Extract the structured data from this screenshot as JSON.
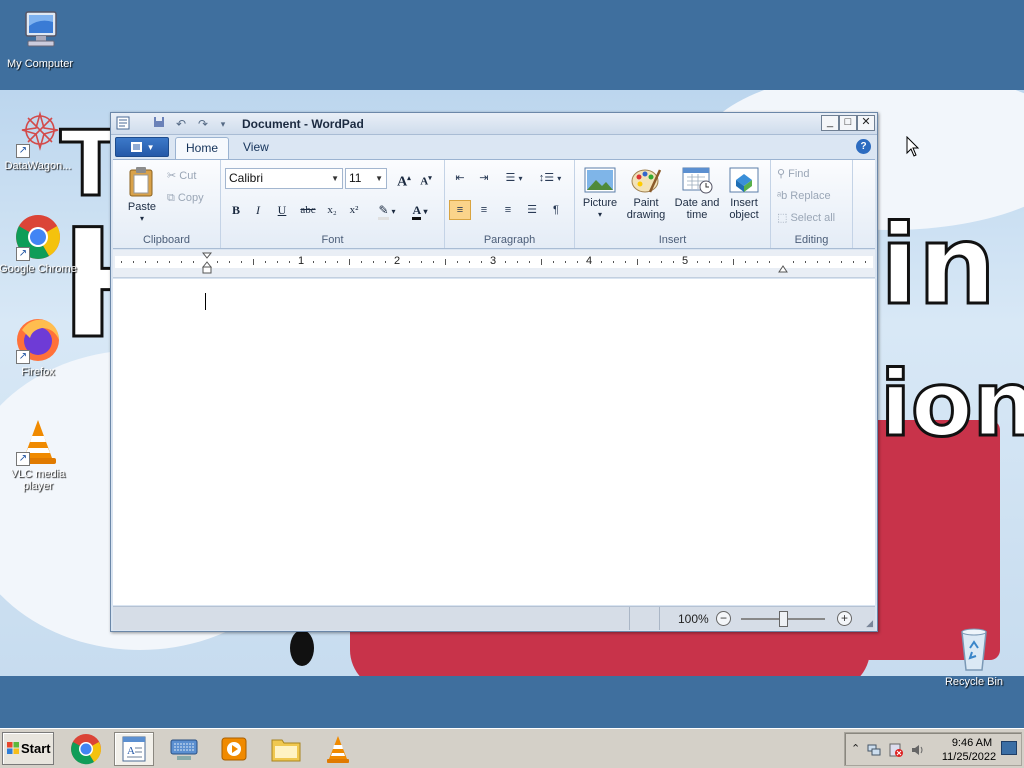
{
  "desktop": {
    "icons": [
      {
        "label": "My Computer"
      },
      {
        "label": "DataWagon..."
      },
      {
        "label": "Google Chrome"
      },
      {
        "label": "Firefox"
      },
      {
        "label": "VLC media player"
      },
      {
        "label": "Recycle Bin"
      }
    ]
  },
  "window": {
    "title": "Document - WordPad",
    "controls": {
      "minimize": "_",
      "maximize": "□",
      "close": "✕"
    },
    "tabs": [
      "Home",
      "View"
    ],
    "ribbon": {
      "clipboard": {
        "label": "Clipboard",
        "paste": "Paste",
        "cut": "Cut",
        "copy": "Copy"
      },
      "font": {
        "label": "Font",
        "family": "Calibri",
        "size": "11",
        "bold": "B",
        "italic": "I",
        "underline": "U",
        "strike": "abc",
        "subscript": "x₂",
        "superscript": "x²"
      },
      "paragraph": {
        "label": "Paragraph"
      },
      "insert": {
        "label": "Insert",
        "picture": "Picture",
        "paint_drawing": "Paint drawing",
        "date_time": "Date and time",
        "insert_object": "Insert object"
      },
      "editing": {
        "label": "Editing",
        "find": "Find",
        "replace": "Replace",
        "select_all": "Select all"
      }
    },
    "ruler": {
      "numbers": [
        "1",
        "2",
        "3",
        "4",
        "5"
      ]
    },
    "status": {
      "zoom": "100%"
    }
  },
  "taskbar": {
    "start_label": "Start",
    "clock_time": "9:46 AM",
    "clock_date": "11/25/2022"
  }
}
